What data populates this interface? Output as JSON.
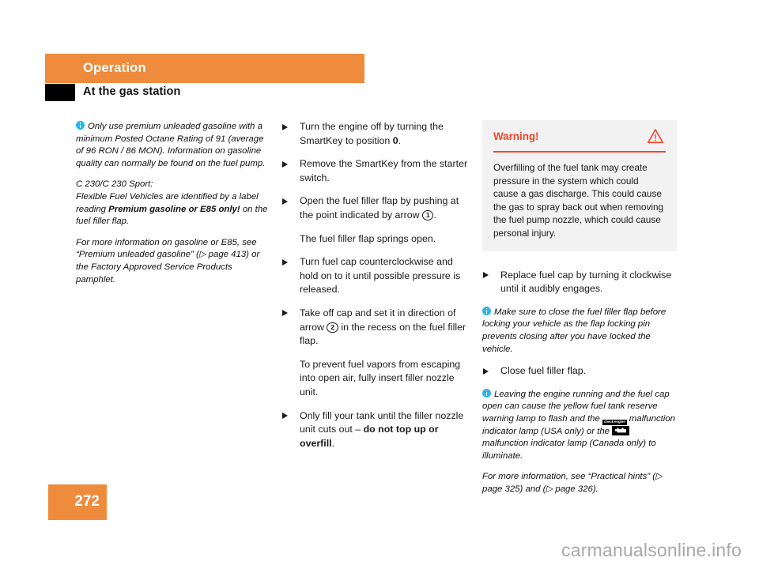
{
  "header": {
    "chapter": "Operation",
    "section_title": "At the gas station",
    "band_color": "#ee8b3c"
  },
  "left_column": {
    "notes": [
      {
        "id": "premium-fuel-note",
        "has_info_icon": true,
        "text": "Only use premium unleaded gasoline with a minimum Posted Octane Rating of 91 (average of 96 RON / 86 MON). Information on gasoline quality can normally be found on the fuel pump."
      },
      {
        "id": "flex-fuel-note",
        "has_info_icon": false,
        "line1": "C 230/C 230 Sport:",
        "text_before": "Flexible Fuel Vehicles are identified by a label reading ",
        "bold": "Premium gasoline or E85 only!",
        "text_after": " on the fuel filler flap."
      },
      {
        "id": "more-info-note",
        "has_info_icon": false,
        "text": "For more information on gasoline or E85, see “Premium unleaded gasoline” (▷ page 413) or the Factory Approved Service Products pamphlet."
      }
    ]
  },
  "middle_column": {
    "steps": [
      {
        "id": "step-turn-engine-off",
        "bullet": true,
        "text_before": "Turn the engine off by turning the SmartKey to position ",
        "bold": "0",
        "text_after": "."
      },
      {
        "id": "step-remove-smartkey",
        "bullet": true,
        "text": "Remove the SmartKey from the starter switch."
      },
      {
        "id": "step-open-filler-flap",
        "bullet": true,
        "text_before": "Open the fuel filler flap by pushing at the point indicated by arrow ",
        "callout": "1",
        "text_after": "."
      },
      {
        "id": "result-flap-springs-open",
        "bullet": false,
        "text": "The fuel filler flap springs open."
      },
      {
        "id": "step-turn-fuel-cap",
        "bullet": true,
        "text": "Turn fuel cap counterclockwise and hold on to it until possible pressure is released."
      },
      {
        "id": "step-take-off-cap",
        "bullet": true,
        "text_before": "Take off cap and set it in direction of arrow ",
        "callout": "2",
        "text_after": " in the recess on the fuel filler flap."
      },
      {
        "id": "note-prevent-vapors",
        "bullet": false,
        "text": "To prevent fuel vapors from escaping into open air, fully insert filler nozzle unit."
      },
      {
        "id": "step-do-not-overfill",
        "bullet": true,
        "text_before": "Only fill your tank until the filler nozzle unit cuts out – ",
        "bold": "do not top up or overfill",
        "text_after": "."
      }
    ]
  },
  "right_column": {
    "warning": {
      "title": "Warning!",
      "icon": "warning-triangle-icon",
      "accent_color": "#f5442a",
      "background_color": "#f2f2f2",
      "text": "Overfilling of the fuel tank may create pressure in the system which could cause a gas discharge. This could cause the gas to spray back out when removing the fuel pump nozzle, which could cause personal injury."
    },
    "steps": [
      {
        "id": "step-replace-fuel-cap",
        "bullet": true,
        "text": "Replace fuel cap by turning it clockwise until it audibly engages."
      },
      {
        "id": "step-close-filler-flap",
        "bullet": true,
        "text": "Close fuel filler flap."
      }
    ],
    "notes": [
      {
        "id": "note-close-flap-before-locking",
        "has_info_icon": true,
        "text": "Make sure to close the fuel filler flap before locking your vehicle as the flap locking pin prevents closing after you have locked the vehicle."
      },
      {
        "id": "note-engine-running",
        "has_info_icon": true,
        "part1": "Leaving the engine running and the fuel cap open can cause the yellow fuel tank reserve warning lamp to flash and the ",
        "icon1_label": "check engine",
        "icon1_name": "check-engine-telltale-icon",
        "part2": " malfunction indicator lamp (USA only) or the ",
        "icon2_name": "engine-malfunction-telltale-icon",
        "part3": " malfunction indicator lamp (Canada only) to illuminate."
      },
      {
        "id": "note-practical-hints",
        "has_info_icon": false,
        "text": "For more information, see “Practical hints” (▷ page 325) and (▷ page 326)."
      }
    ]
  },
  "footer": {
    "page_number": "272",
    "badge_color": "#ee8b3c",
    "watermark": "carmanualsonline.info"
  }
}
